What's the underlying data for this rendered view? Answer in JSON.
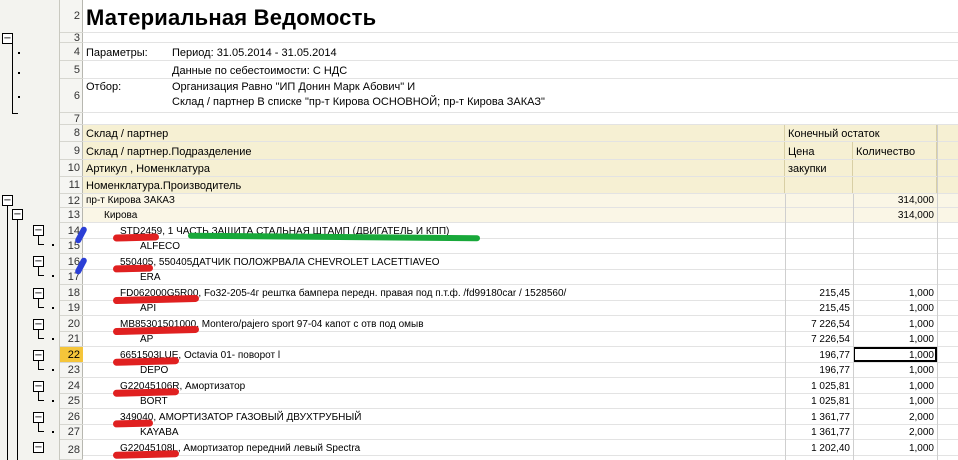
{
  "title": "Материальная Ведомость",
  "params": {
    "label": "Параметры:",
    "period": "Период: 31.05.2014 - 31.05.2014",
    "cost_data": "Данные по себестоимости: С НДС"
  },
  "filter": {
    "label": "Отбор:",
    "line1": "Организация Равно \"ИП Донин Марк Абович\" И",
    "line2": "Склад / партнер В списке \"пр-т Кирова ОСНОВНОЙ; пр-т Кирова ЗАКАЗ\""
  },
  "headers": {
    "h8_left": "Склад / партнер",
    "h8_right": "Конечный остаток",
    "h9_left": "Склад / партнер.Подразделение",
    "h9_price": "Цена",
    "h9_qty": "Количество",
    "h10_left": "Артикул , Номенклатура",
    "h10_price": "закупки",
    "h11_left": "Номенклатура.Производитель"
  },
  "group": {
    "name": "пр-т Кирова ЗАКАЗ",
    "qty": "314,000",
    "sub": "Кирова",
    "sub_qty": "314,000"
  },
  "row_numbers": [
    "2",
    "3",
    "4",
    "5",
    "6",
    "7",
    "8",
    "9",
    "10",
    "11",
    "12",
    "13",
    "14",
    "15",
    "16",
    "17",
    "18",
    "19",
    "20",
    "21",
    "22",
    "23",
    "24",
    "25",
    "26",
    "27",
    "28"
  ],
  "items": [
    {
      "row": "14",
      "article": "STD2459",
      "name": ", 1 ЧАСТЬ ЗАЩИТА СТАЛЬНАЯ ШТАМП (ДВИГАТЕЛЬ И КПП)",
      "price": "",
      "qty": "",
      "mfr_row": "15",
      "mfr": "ALFECO",
      "mfr_price": "",
      "mfr_qty": ""
    },
    {
      "row": "16",
      "article": "550405",
      "name": ", 550405ДАТЧИК ПОЛОЖРВАЛА CHEVROLET LACETTIAVEO",
      "price": "",
      "qty": "",
      "mfr_row": "17",
      "mfr": "ERA",
      "mfr_price": "",
      "mfr_qty": ""
    },
    {
      "row": "18",
      "article": "FD062000G5R00",
      "name": ", Fo32-205-4г рештка бампера передн. правая под п.т.ф. /fd99180car / 1528560/",
      "price": "215,45",
      "qty": "1,000",
      "mfr_row": "19",
      "mfr": "API",
      "mfr_price": "215,45",
      "mfr_qty": "1,000"
    },
    {
      "row": "20",
      "article": "MB85301501000",
      "name": ", Montero/pajero sport 97-04 капот с отв под омыв",
      "price": "7 226,54",
      "qty": "1,000",
      "mfr_row": "21",
      "mfr": "AP",
      "mfr_price": "7 226,54",
      "mfr_qty": "1,000"
    },
    {
      "row": "22",
      "article": "6651503LUE",
      "name": ", Octavia 01- поворот l",
      "price": "196,77",
      "qty": "1,000",
      "mfr_row": "23",
      "mfr": "DEPO",
      "mfr_price": "196,77",
      "mfr_qty": "1,000"
    },
    {
      "row": "24",
      "article": "G22045106R",
      "name": ", Амортизатор",
      "price": "1 025,81",
      "qty": "1,000",
      "mfr_row": "25",
      "mfr": "BORT",
      "mfr_price": "1 025,81",
      "mfr_qty": "1,000"
    },
    {
      "row": "26",
      "article": "349040",
      "name": ", АМОРТИЗАТОР ГАЗОВЫЙ ДВУХТРУБНЫЙ",
      "price": "1 361,77",
      "qty": "2,000",
      "mfr_row": "27",
      "mfr": "KAYABA",
      "mfr_price": "1 361,77",
      "mfr_qty": "2,000"
    },
    {
      "row": "28",
      "article": "G22045108L",
      "name": ", Амортизатор передний левый Spectra",
      "price": "1 202,40",
      "qty": "1,000",
      "mfr_row": "",
      "mfr": "",
      "mfr_price": "",
      "mfr_qty": ""
    }
  ],
  "active_row": "22",
  "colors": {
    "header_bg": "#f6f0d3",
    "active_row": "#f5c53a",
    "red_mark": "#e02020",
    "green_mark": "#18a83a",
    "blue_mark": "#2b3fd6"
  }
}
